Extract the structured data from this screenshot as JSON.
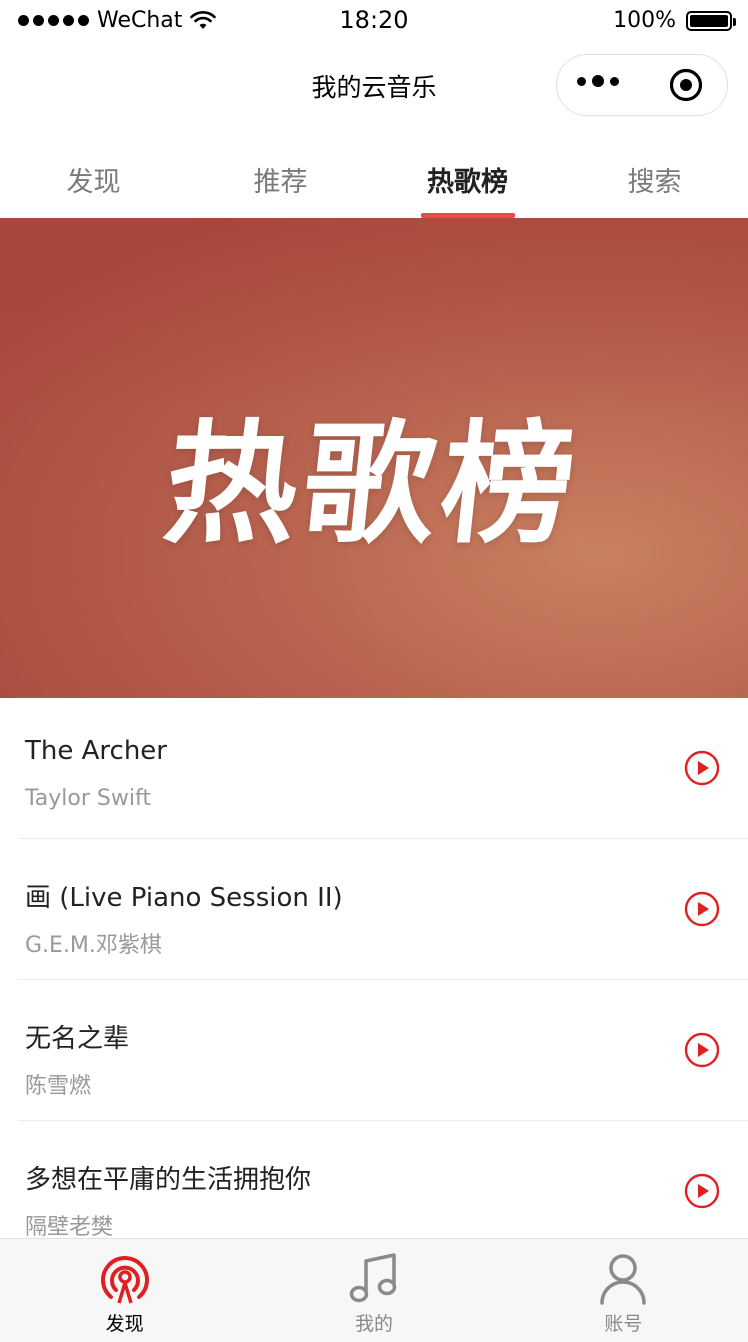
{
  "status_bar": {
    "carrier": "WeChat",
    "time": "18:20",
    "battery_percent": "100%",
    "battery_level": 1.0
  },
  "navbar": {
    "title": "我的云音乐"
  },
  "tabs": [
    {
      "label": "发现"
    },
    {
      "label": "推荐"
    },
    {
      "label": "热歌榜",
      "active": true
    },
    {
      "label": "搜索"
    }
  ],
  "banner": {
    "title": "热歌榜"
  },
  "songs": [
    {
      "title": "The Archer",
      "artist": "Taylor Swift"
    },
    {
      "title": "画 (Live Piano Session II)",
      "artist": "G.E.M.邓紫棋"
    },
    {
      "title": "无名之辈",
      "artist": "陈雪燃"
    },
    {
      "title": "多想在平庸的生活拥抱你",
      "artist": "隔壁老樊"
    }
  ],
  "tabbar": [
    {
      "label": "发现",
      "icon": "radio-icon",
      "active": true
    },
    {
      "label": "我的",
      "icon": "music-note-icon"
    },
    {
      "label": "账号",
      "icon": "user-icon"
    }
  ],
  "colors": {
    "accent": "#e84a4a",
    "play_icon": "#e02020",
    "banner": "#b25848"
  }
}
